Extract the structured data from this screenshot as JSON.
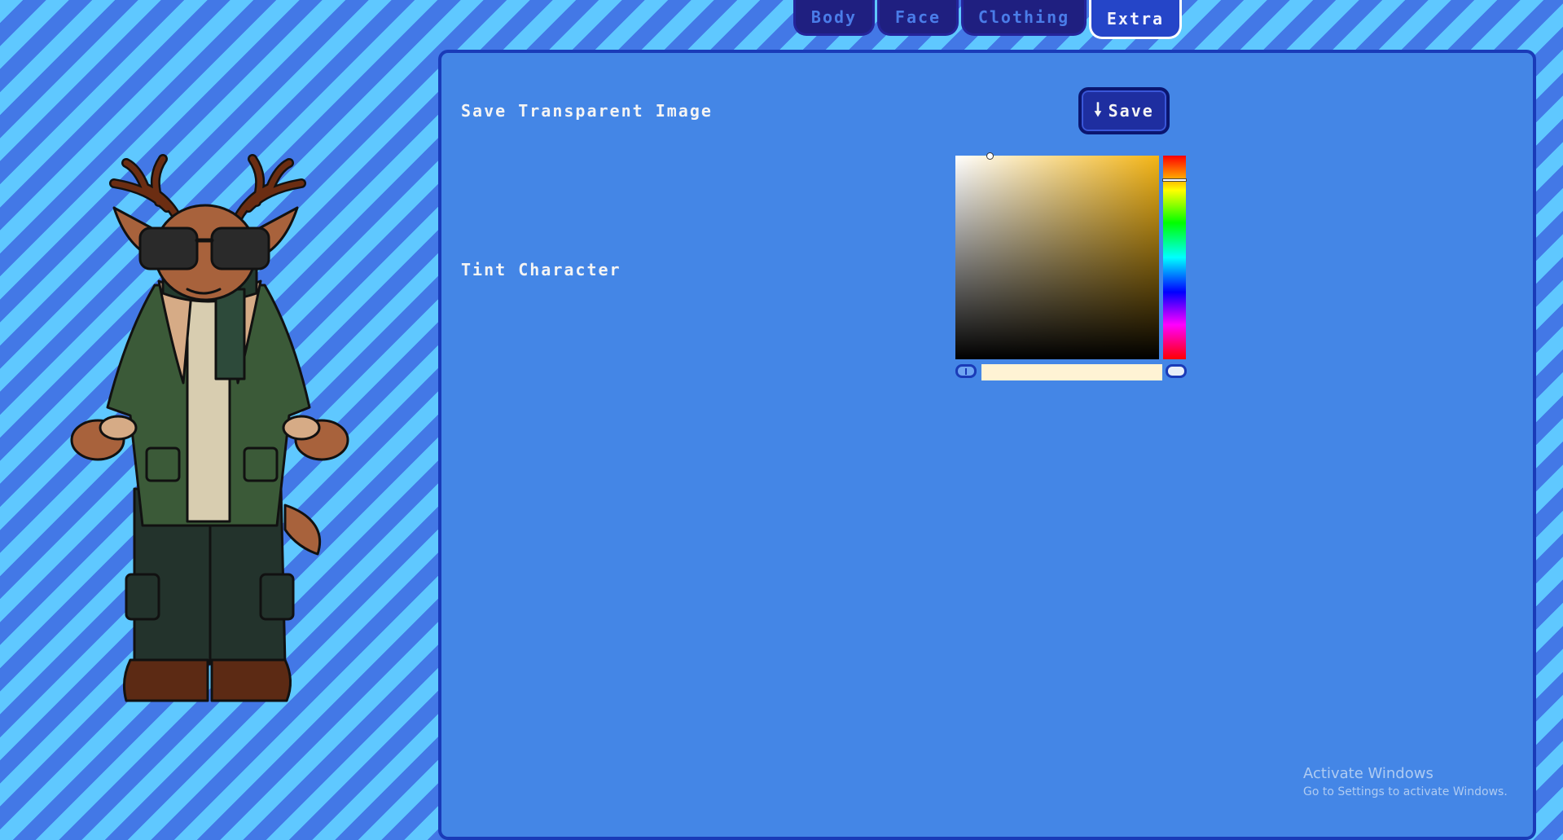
{
  "tabs": [
    {
      "label": "Body",
      "active": false
    },
    {
      "label": "Face",
      "active": false
    },
    {
      "label": "Clothing",
      "active": false
    },
    {
      "label": "Extra",
      "active": true
    }
  ],
  "extra_panel": {
    "save_row_label": "Save Transparent Image",
    "save_button_label": "Save",
    "save_button_icon": "down-arrow-icon",
    "tint_row_label": "Tint Character"
  },
  "color_picker": {
    "hue_color": "#f4b516",
    "selected_color": "#fff3d4"
  },
  "watermark": {
    "title": "Activate Windows",
    "subtitle": "Go to Settings to activate Windows."
  },
  "colors": {
    "background_stripe_light": "#5fc8ff",
    "background_stripe_dark": "#4378e6",
    "panel_background": "#4486e6",
    "panel_border": "#1a3bb8",
    "tab_background": "#1f1f80",
    "tab_active_background": "#2545c8"
  }
}
